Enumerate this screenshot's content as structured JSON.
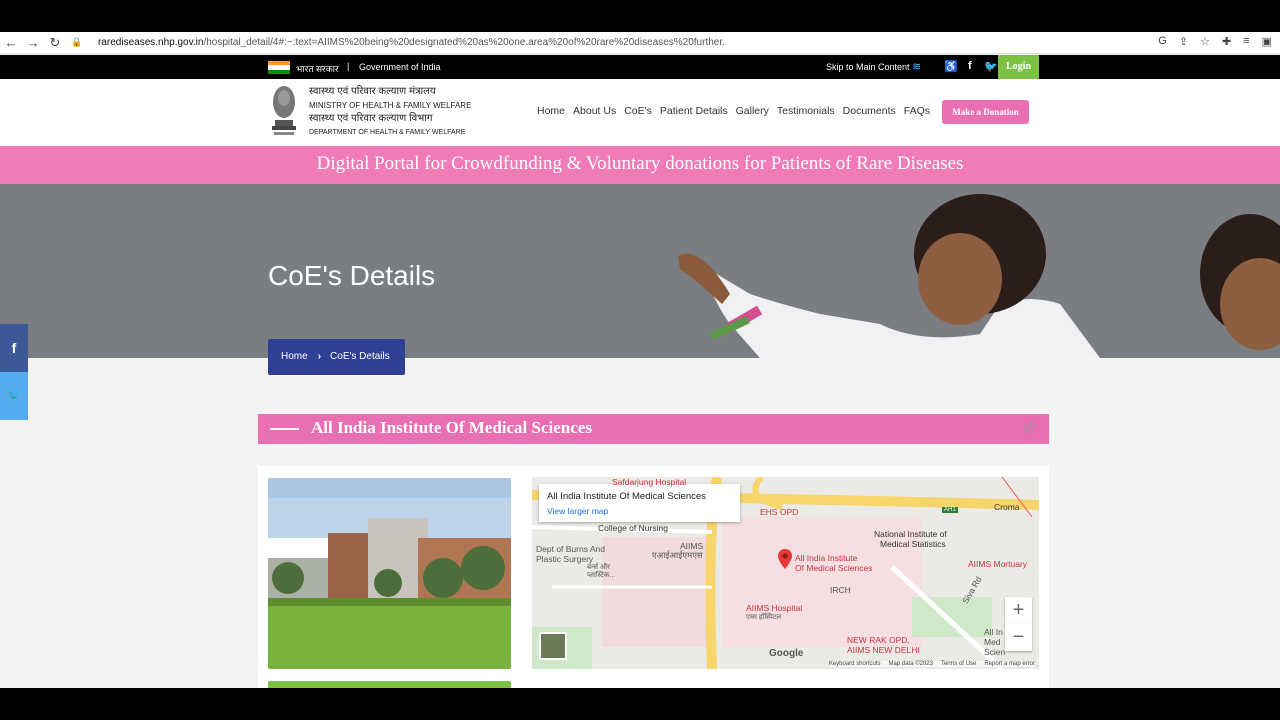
{
  "browser": {
    "url_host": "rarediseases.nhp.gov.in",
    "url_path": "/hospital_detail/4#:~:text=AIIMS%20being%20designated%20as%20one.area%20of%20rare%20diseases%20further."
  },
  "govbar": {
    "hindi": "भारत सरकार",
    "separator": "|",
    "english": "Government of India",
    "skip": "Skip to Main Content",
    "login": "Login"
  },
  "header": {
    "ministry_hi": "स्वास्थ्य एवं परिवार कल्याण मंत्रालय",
    "ministry_en": "MINISTRY OF HEALTH & FAMILY WELFARE",
    "dept_hi": "स्वास्थ्य एवं परिवार कल्याण विभाग",
    "dept_en": "DEPARTMENT OF HEALTH & FAMILY WELFARE",
    "menu": [
      "Home",
      "About Us",
      "CoE's",
      "Patient Details",
      "Gallery",
      "Testimonials",
      "Documents",
      "FAQs"
    ],
    "donate": "Make a Donation"
  },
  "portal_title": "Digital Portal for Crowdfunding & Voluntary donations for Patients of Rare Diseases",
  "hero": {
    "title": "CoE's Details",
    "crumb_home": "Home",
    "crumb_current": "CoE's Details"
  },
  "social": {
    "facebook": "f",
    "twitter": "t"
  },
  "section": {
    "title": "All India Institute Of Medical Sciences"
  },
  "map": {
    "info_title": "All India Institute Of Medical Sciences",
    "info_link": "View larger map",
    "labels": {
      "safdarjung": "Safdarjung Hospital",
      "ehs": "EHS OPD",
      "nursing": "College of Nursing",
      "burns": "Dept of Burns And",
      "burns2": "Plastic Surgery",
      "burns3": "बर्न्स और",
      "burns4": "प्लास्टिक...",
      "aiims_hi": "एआईआईएमएस",
      "aiims": "AIIMS",
      "nims": "National Institute of",
      "nims2": "Medical Statistics",
      "main": "All India Institute",
      "main2": "Of Medical Sciences",
      "mortuary": "AIIMS Mortuary",
      "irch": "IRCH",
      "siva": "Siva Rd",
      "hospital": "AIIMS Hospital",
      "hospital_hi": "एम्स हॉस्पिटल",
      "newrak": "NEW RAK OPD,",
      "newrak2": "AIIMS NEW DELHI",
      "croma": "Croma",
      "ah1": "AH1",
      "allin": "All In",
      "allin2": "Med",
      "allin3": "Scien"
    },
    "zoom_in": "+",
    "zoom_out": "−",
    "google": "Google",
    "attribution": [
      "Keyboard shortcuts",
      "Map data ©2023",
      "Terms of Use",
      "Report a map error"
    ]
  },
  "colors": {
    "pink": "#f07bb7",
    "navy": "#2f3f94",
    "green": "#7bc142"
  }
}
